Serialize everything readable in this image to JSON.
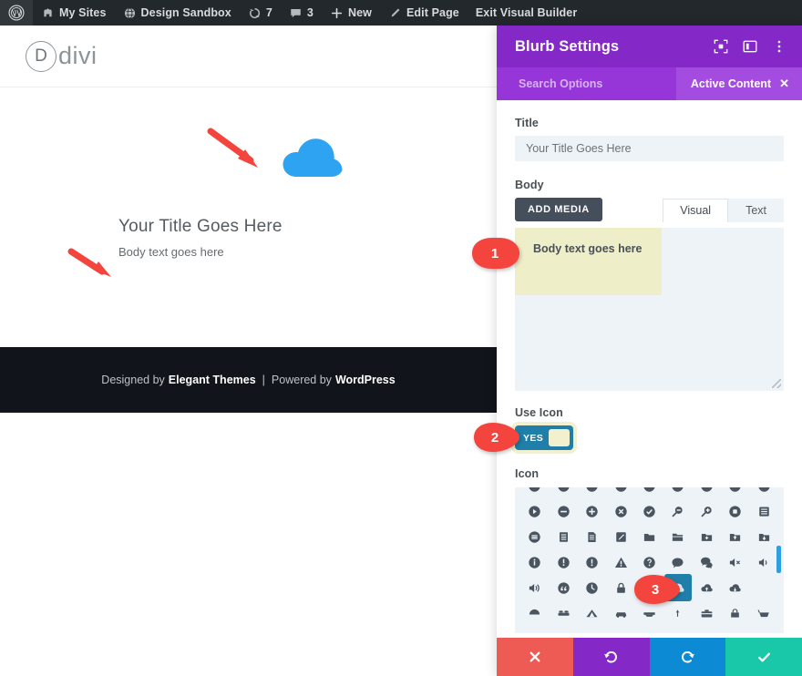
{
  "adminbar": {
    "items": [
      {
        "icon": "wordpress-logo-icon",
        "label": ""
      },
      {
        "icon": "my-sites-icon",
        "label": "My Sites"
      },
      {
        "icon": "site-icon",
        "label": "Design Sandbox"
      },
      {
        "icon": "updates-icon",
        "label": "7"
      },
      {
        "icon": "comments-icon",
        "label": "3"
      },
      {
        "icon": "plus-icon",
        "label": "New"
      },
      {
        "icon": "pencil-icon",
        "label": "Edit Page"
      },
      {
        "icon": "",
        "label": "Exit Visual Builder"
      }
    ]
  },
  "preview": {
    "logo": {
      "mark": "D",
      "word": "divi"
    },
    "blurb": {
      "icon_name": "cloud-icon",
      "icon_color": "#2EA3F2",
      "title": "Your Title Goes Here",
      "body": "Body text goes here"
    },
    "footer": {
      "designed_by": "Designed by",
      "designer": "Elegant Themes",
      "separator": "|",
      "powered_by": "Powered by",
      "platform": "WordPress"
    }
  },
  "modal": {
    "title": "Blurb Settings",
    "header_icons": [
      "focus-target-icon",
      "panel-layout-icon",
      "more-vertical-icon"
    ],
    "tabs": {
      "search_placeholder": "Search Options",
      "active_tab": "Active Content",
      "close_label": "✕"
    },
    "fields": {
      "title_label": "Title",
      "title_value": "Your Title Goes Here",
      "body_label": "Body",
      "add_media_label": "ADD MEDIA",
      "editor_tabs": [
        {
          "label": "Visual",
          "active": true
        },
        {
          "label": "Text",
          "active": false
        }
      ],
      "body_value": "Body text goes here",
      "use_icon_label": "Use Icon",
      "use_icon_state": "YES",
      "icon_label": "Icon"
    },
    "icon_grid": {
      "rows": [
        [
          "play-circle-icon",
          "minus-circle-icon",
          "plus-circle-icon",
          "x-circle-icon",
          "check-circle-icon",
          "zoom-out-icon",
          "zoom-in-icon",
          "stop-circle-icon",
          "list-box-icon"
        ],
        [
          "menu-circle-icon",
          "list-lines-icon",
          "document-lines-icon",
          "pencil-diagonal-icon",
          "folder-icon",
          "folder-open-icon",
          "folder-plus-icon",
          "folder-up-icon",
          "folder-down-icon"
        ],
        [
          "info-circle-icon",
          "exclamation-circle-icon",
          "alert-circle-icon",
          "warning-triangle-icon",
          "question-circle-icon",
          "comment-icon",
          "comments-icon",
          "volume-mute-icon",
          "volume-low-icon"
        ],
        [
          "volume-high-icon",
          "quote-circle-icon",
          "clock-icon",
          "lock-icon",
          "unlock-icon",
          "cloud-icon",
          "cloud-up-icon",
          "cloud-down-icon"
        ],
        [
          "umbrella-icon",
          "bed-icon",
          "tent-icon",
          "car-icon",
          "truck-icon",
          "pin-icon",
          "briefcase-icon",
          "bag-icon",
          "cart-icon"
        ]
      ],
      "selected": "cloud-icon",
      "selected_row": 3,
      "selected_col": 6
    },
    "footer_buttons": [
      {
        "name": "cancel",
        "glyph": "✕",
        "color": "#EE5B55"
      },
      {
        "name": "undo",
        "glyph": "↺",
        "color": "#8428C8"
      },
      {
        "name": "redo",
        "glyph": "↻",
        "color": "#0C8AD4"
      },
      {
        "name": "save",
        "glyph": "✓",
        "color": "#18C8A8"
      }
    ]
  },
  "annotations": [
    {
      "number": "1",
      "target": "body-text-field"
    },
    {
      "number": "2",
      "target": "use-icon-toggle"
    },
    {
      "number": "3",
      "target": "cloud-icon-selection"
    }
  ]
}
